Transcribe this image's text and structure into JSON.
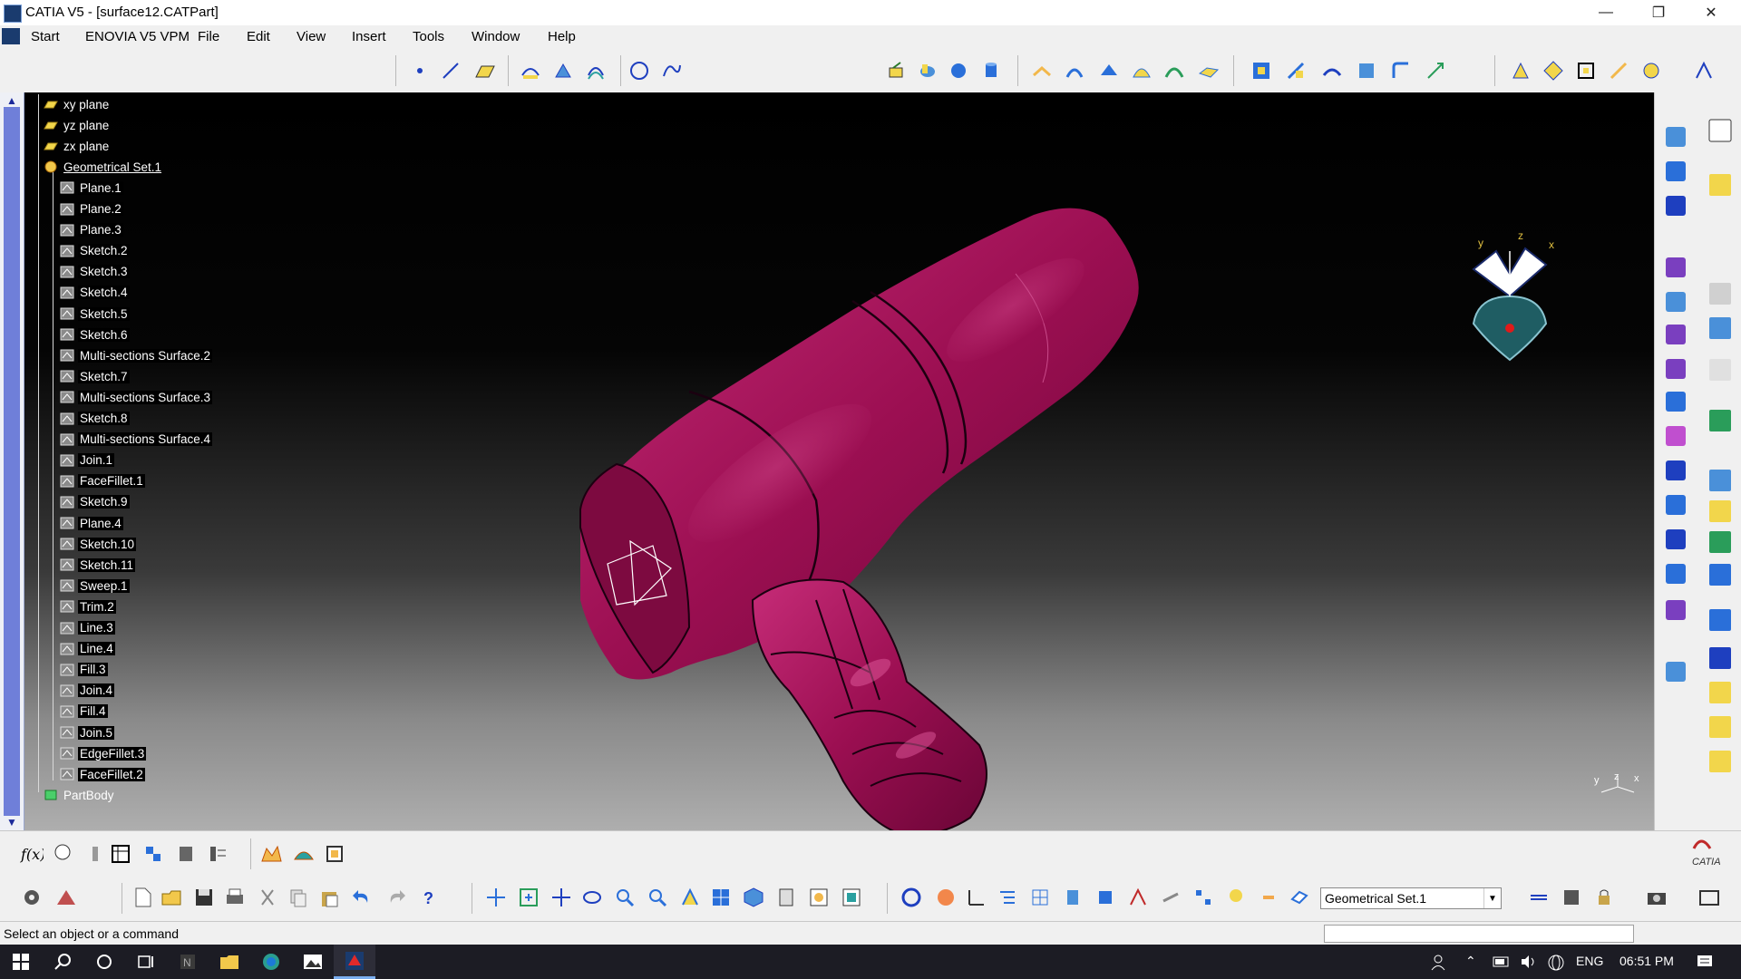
{
  "window": {
    "title": "CATIA V5 - [surface12.CATPart]",
    "minimize": "—",
    "restore": "❐",
    "close": "✕"
  },
  "menu": {
    "items": [
      "Start",
      "ENOVIA V5 VPM",
      "File",
      "Edit",
      "View",
      "Insert",
      "Tools",
      "Window",
      "Help"
    ]
  },
  "tree": {
    "items": [
      {
        "label": "xy plane",
        "kind": "plane"
      },
      {
        "label": "yz plane",
        "kind": "plane"
      },
      {
        "label": "zx plane",
        "kind": "plane"
      },
      {
        "label": "Geometrical Set.1",
        "kind": "set"
      },
      {
        "label": "Plane.1",
        "kind": "feature"
      },
      {
        "label": "Plane.2",
        "kind": "feature"
      },
      {
        "label": "Plane.3",
        "kind": "feature"
      },
      {
        "label": "Sketch.2",
        "kind": "feature"
      },
      {
        "label": "Sketch.3",
        "kind": "feature"
      },
      {
        "label": "Sketch.4",
        "kind": "feature"
      },
      {
        "label": "Sketch.5",
        "kind": "feature"
      },
      {
        "label": "Sketch.6",
        "kind": "feature"
      },
      {
        "label": "Multi-sections Surface.2",
        "kind": "feature"
      },
      {
        "label": "Sketch.7",
        "kind": "feature"
      },
      {
        "label": "Multi-sections Surface.3",
        "kind": "feature"
      },
      {
        "label": "Sketch.8",
        "kind": "feature"
      },
      {
        "label": "Multi-sections Surface.4",
        "kind": "feature"
      },
      {
        "label": "Join.1",
        "kind": "feature"
      },
      {
        "label": "FaceFillet.1",
        "kind": "feature"
      },
      {
        "label": "Sketch.9",
        "kind": "feature"
      },
      {
        "label": "Plane.4",
        "kind": "feature"
      },
      {
        "label": "Sketch.10",
        "kind": "feature"
      },
      {
        "label": "Sketch.11",
        "kind": "feature"
      },
      {
        "label": "Sweep.1",
        "kind": "feature"
      },
      {
        "label": "Trim.2",
        "kind": "feature"
      },
      {
        "label": "Line.3",
        "kind": "feature"
      },
      {
        "label": "Line.4",
        "kind": "feature"
      },
      {
        "label": "Fill.3",
        "kind": "feature"
      },
      {
        "label": "Join.4",
        "kind": "feature"
      },
      {
        "label": "Fill.4",
        "kind": "feature"
      },
      {
        "label": "Join.5",
        "kind": "feature"
      },
      {
        "label": "EdgeFillet.3",
        "kind": "feature"
      },
      {
        "label": "FaceFillet.2",
        "kind": "feature"
      },
      {
        "label": "PartBody",
        "kind": "body"
      }
    ]
  },
  "compass": {
    "x": "x",
    "y": "y",
    "z": "z"
  },
  "axis_indicator": {
    "x": "x",
    "y": "y",
    "z": "z"
  },
  "selector": {
    "value": "Geometrical Set.1",
    "arrow": "▼"
  },
  "status": {
    "text": "Select an object or a command"
  },
  "taskbar": {
    "language": "ENG",
    "time": "06:51 PM"
  },
  "brand": {
    "logo_text": "CATIA"
  },
  "colors": {
    "part": "#9c0f52",
    "viewport_top": "#000000",
    "viewport_bottom": "#aeaeae",
    "selection": "#000000",
    "tree_text": "#ffffff"
  }
}
